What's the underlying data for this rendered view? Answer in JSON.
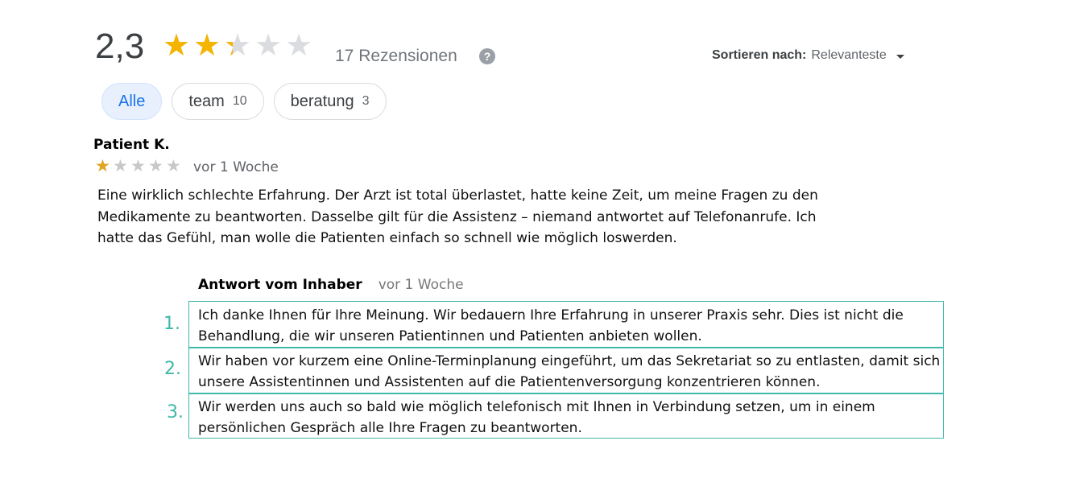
{
  "summary": {
    "rating": "2,3",
    "rating_value": 2.3,
    "max_stars": 5,
    "review_count": "17 Rezensionen",
    "help_icon": "?",
    "star_color": "#f4b400"
  },
  "sort": {
    "label": "Sortieren nach:",
    "value": "Relevanteste"
  },
  "chips": [
    {
      "label": "Alle",
      "count": "",
      "active": true
    },
    {
      "label": "team",
      "count": "10",
      "active": false
    },
    {
      "label": "beratung",
      "count": "3",
      "active": false
    }
  ],
  "review": {
    "author": "Patient K.",
    "stars": 1,
    "date": "vor 1 Woche",
    "text": "Eine wirklich schlechte Erfahrung. Der Arzt ist total überlastet, hatte keine Zeit, um meine Fragen zu den Medikamente zu beantworten. Dasselbe gilt für die Assistenz – niemand antwortet auf Telefonanrufe. Ich hatte das Gefühl, man wolle die Patienten einfach so schnell wie möglich loswerden."
  },
  "owner_response": {
    "label": "Antwort vom Inhaber",
    "date": "vor 1 Woche",
    "accent_color": "#3fb8a9",
    "parts": [
      {
        "number": "1.",
        "text": "Ich danke Ihnen für Ihre Meinung. Wir bedauern Ihre Erfahrung in unserer Praxis sehr. Dies ist nicht die Behandlung, die wir unseren Patientinnen und Patienten anbieten wollen."
      },
      {
        "number": "2.",
        "text": "Wir haben vor kurzem eine Online-Terminplanung eingeführt, um das Sekretariat so zu entlasten, damit sich unsere Assistentinnen und Assistenten auf die Patientenversorgung konzentrieren können."
      },
      {
        "number": "3.",
        "text": "Wir werden uns auch so bald wie möglich telefonisch mit Ihnen in Verbindung setzen, um in einem persönlichen Gespräch alle Ihre Fragen zu beantworten."
      }
    ]
  }
}
